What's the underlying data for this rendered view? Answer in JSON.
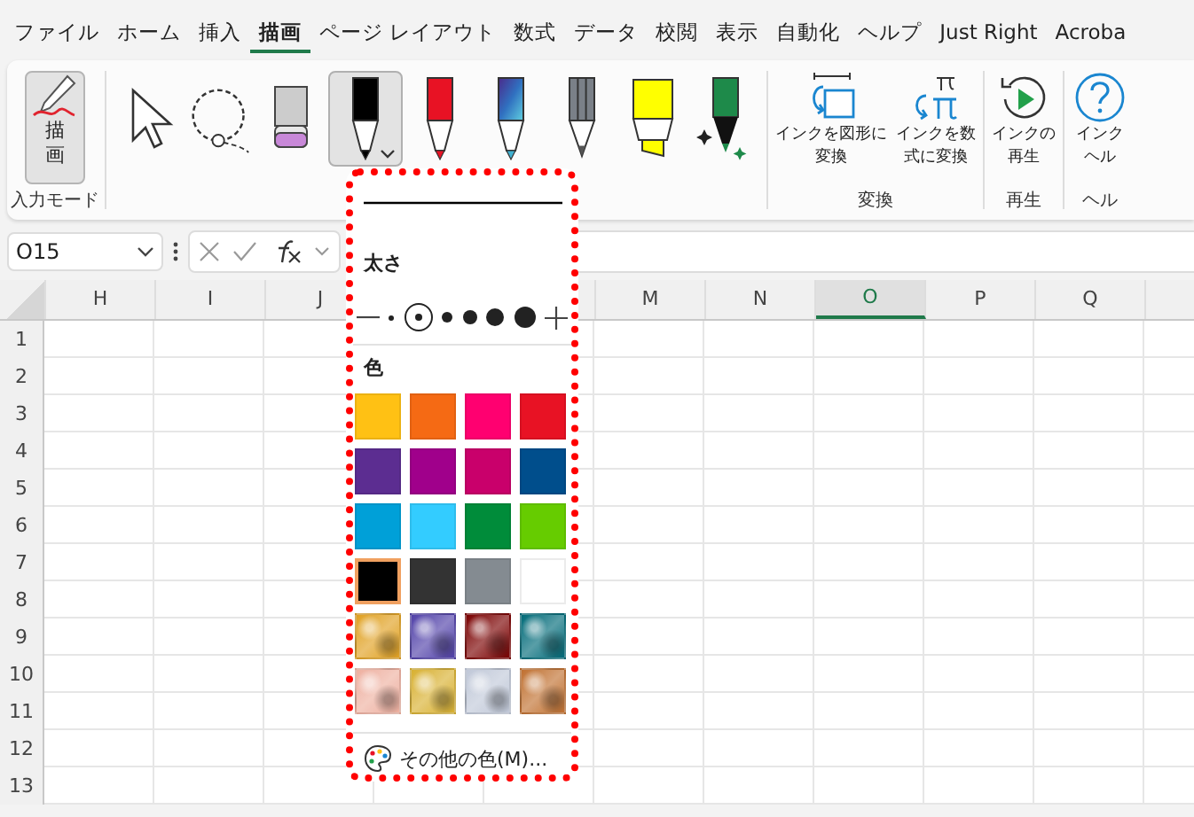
{
  "menu_tabs": [
    {
      "label": "ファイル",
      "selected": false
    },
    {
      "label": "ホーム",
      "selected": false
    },
    {
      "label": "挿入",
      "selected": false
    },
    {
      "label": "描画",
      "selected": true
    },
    {
      "label": "ページ レイアウト",
      "selected": false
    },
    {
      "label": "数式",
      "selected": false
    },
    {
      "label": "データ",
      "selected": false
    },
    {
      "label": "校閲",
      "selected": false
    },
    {
      "label": "表示",
      "selected": false
    },
    {
      "label": "自動化",
      "selected": false
    },
    {
      "label": "ヘルプ",
      "selected": false
    },
    {
      "label": "Just Right",
      "selected": false
    },
    {
      "label": "Acroba",
      "selected": false
    }
  ],
  "ribbon": {
    "mode_group": {
      "label": "入力モード",
      "button": {
        "label": "描画",
        "selected": true
      }
    },
    "tools": [
      {
        "kind": "select",
        "selected": false
      },
      {
        "kind": "lasso",
        "selected": false
      },
      {
        "kind": "eraser",
        "selected": false
      },
      {
        "kind": "pen",
        "color": "#000000",
        "selected": true
      },
      {
        "kind": "pen",
        "color": "#e81224",
        "selected": false
      },
      {
        "kind": "galaxy-pen",
        "selected": false
      },
      {
        "kind": "pencil",
        "color": "#7a8088",
        "selected": false
      },
      {
        "kind": "highlighter",
        "color": "#ffff00",
        "selected": false
      },
      {
        "kind": "action-pen",
        "selected": false
      }
    ],
    "groups": [
      {
        "label": "変換",
        "buttons": [
          {
            "kind": "shape",
            "lines": [
              "インクを図形に",
              "変換"
            ]
          },
          {
            "kind": "math",
            "lines": [
              "インクを数",
              "式に変換"
            ]
          }
        ]
      },
      {
        "label": "再生",
        "buttons": [
          {
            "kind": "replay",
            "lines": [
              "インクの",
              "再生"
            ]
          }
        ]
      },
      {
        "label": "ヘル",
        "buttons": [
          {
            "kind": "help",
            "lines": [
              "インク",
              "ヘル"
            ]
          }
        ]
      }
    ]
  },
  "formula_bar": {
    "name_box": "O15"
  },
  "sheet": {
    "columns_left": [
      {
        "label": "H",
        "selected": false
      },
      {
        "label": "I",
        "selected": false
      },
      {
        "label": "J",
        "selected": false
      }
    ],
    "columns_right": [
      {
        "label": "M",
        "selected": false
      },
      {
        "label": "N",
        "selected": false
      },
      {
        "label": "O",
        "selected": true
      },
      {
        "label": "P",
        "selected": false
      },
      {
        "label": "Q",
        "selected": false
      }
    ],
    "rows": [
      "1",
      "2",
      "3",
      "4",
      "5",
      "6",
      "7",
      "8",
      "9",
      "10",
      "11",
      "12",
      "13"
    ]
  },
  "pen_menu": {
    "thickness_label": "太さ",
    "thickness": [
      {
        "selected": false
      },
      {
        "selected": true
      },
      {
        "selected": false
      },
      {
        "selected": false
      },
      {
        "selected": false
      },
      {
        "selected": false
      }
    ],
    "color_label": "色",
    "colors": [
      {
        "kind": "solid",
        "color": "#ffc114",
        "selected": false
      },
      {
        "kind": "solid",
        "color": "#f56a14",
        "selected": false
      },
      {
        "kind": "solid",
        "color": "#ff0070",
        "selected": false
      },
      {
        "kind": "solid",
        "color": "#e81224",
        "selected": false
      },
      {
        "kind": "solid",
        "color": "#5c2d91",
        "selected": false
      },
      {
        "kind": "solid",
        "color": "#a0008b",
        "selected": false
      },
      {
        "kind": "solid",
        "color": "#c9006b",
        "selected": false
      },
      {
        "kind": "solid",
        "color": "#004e8c",
        "selected": false
      },
      {
        "kind": "solid",
        "color": "#00a0d8",
        "selected": false
      },
      {
        "kind": "solid",
        "color": "#33ccff",
        "selected": false
      },
      {
        "kind": "solid",
        "color": "#008c3a",
        "selected": false
      },
      {
        "kind": "solid",
        "color": "#66cc00",
        "selected": false
      },
      {
        "kind": "solid",
        "color": "#000000",
        "selected": true
      },
      {
        "kind": "solid",
        "color": "#333333",
        "selected": false
      },
      {
        "kind": "solid",
        "color": "#848b91",
        "selected": false
      },
      {
        "kind": "solid",
        "color": "#ffffff",
        "selected": false
      },
      {
        "kind": "texture",
        "color": "#e0a020",
        "selected": false
      },
      {
        "kind": "texture",
        "color": "#5040a8",
        "selected": false
      },
      {
        "kind": "texture",
        "color": "#7a0000",
        "selected": false
      },
      {
        "kind": "texture",
        "color": "#006a78",
        "selected": false
      },
      {
        "kind": "texture",
        "color": "#eeb0a0",
        "selected": false
      },
      {
        "kind": "texture",
        "color": "#d8b030",
        "selected": false
      },
      {
        "kind": "texture",
        "color": "#c0c8d8",
        "selected": false
      },
      {
        "kind": "texture",
        "color": "#c07030",
        "selected": false
      }
    ],
    "more_colors": "その他の色(M)..."
  }
}
